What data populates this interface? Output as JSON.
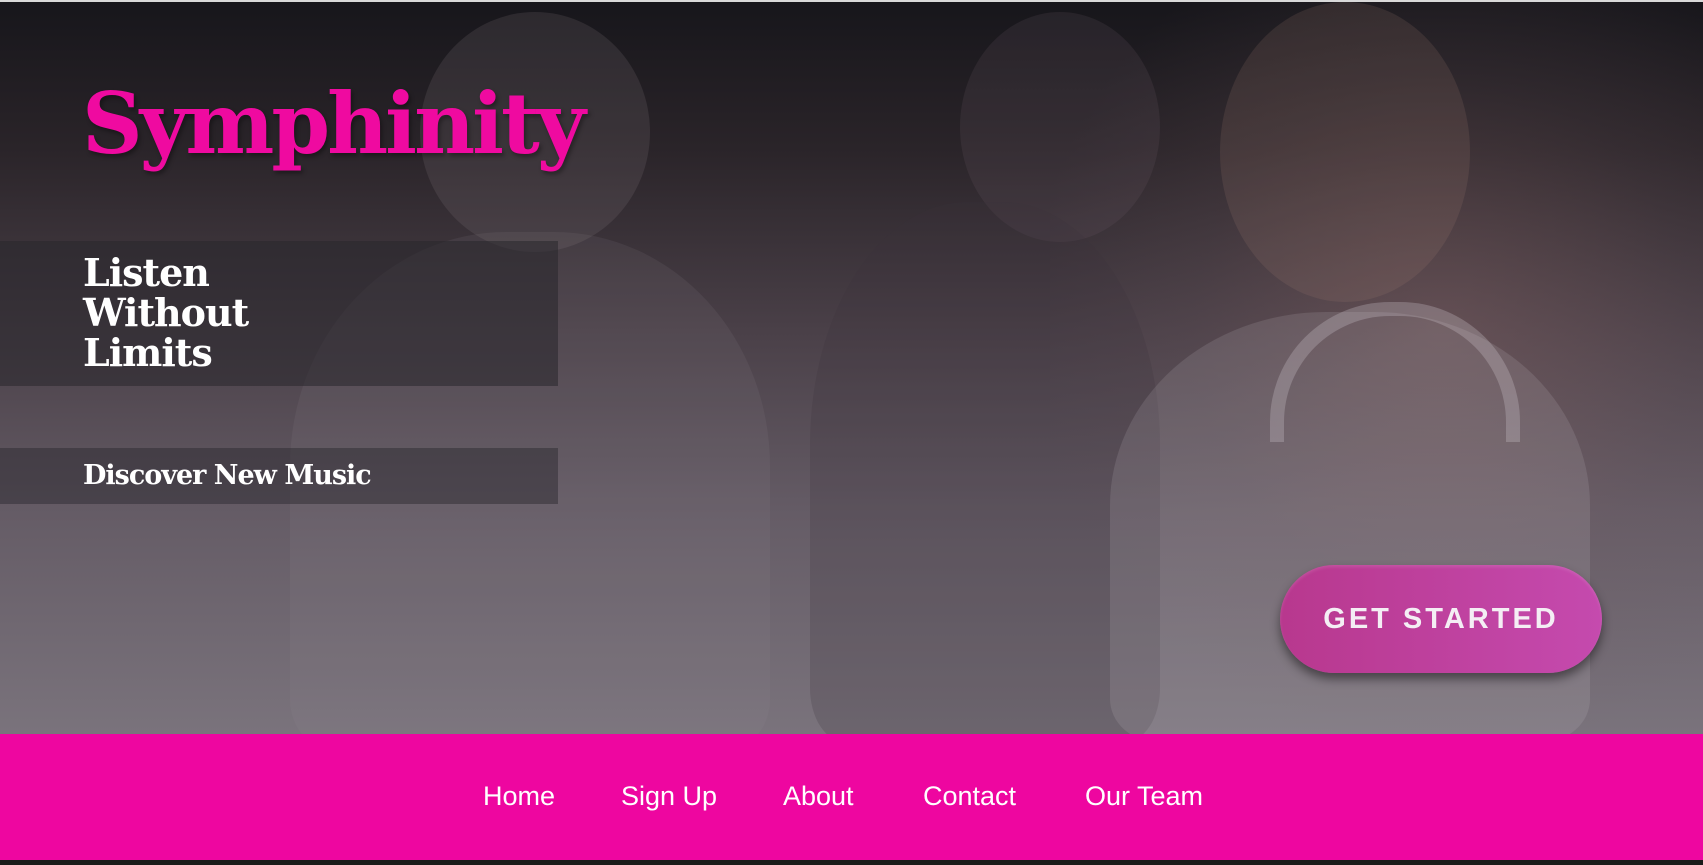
{
  "brand": {
    "title": "Symphinity",
    "title_color": "#ef0aa0"
  },
  "hero": {
    "tagline_lines": [
      "Listen",
      "Without",
      "Limits"
    ],
    "subtitle": "Discover New Music",
    "cta_label": "GET STARTED",
    "cta_color": "#c044a3",
    "background_image": "photo of three laughing friends, one wearing white headphones"
  },
  "nav": {
    "background_color": "#ee06a0",
    "items": [
      {
        "label": "Home"
      },
      {
        "label": "Sign Up"
      },
      {
        "label": "About"
      },
      {
        "label": "Contact"
      },
      {
        "label": "Our Team"
      }
    ]
  }
}
